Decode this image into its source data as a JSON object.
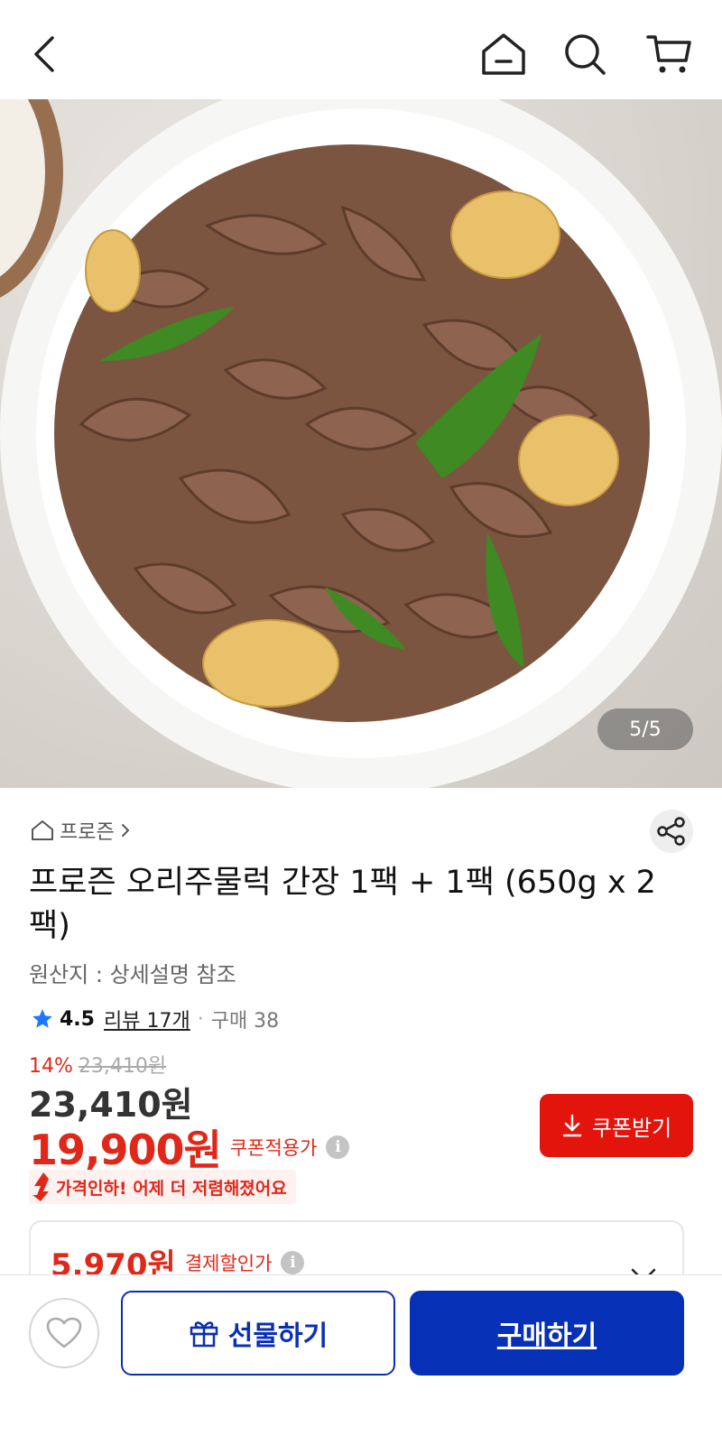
{
  "header": {
    "back_icon": "chevron-left-icon",
    "home_icon": "home-icon",
    "search_icon": "search-icon",
    "cart_icon": "cart-icon"
  },
  "gallery": {
    "counter": "5/5"
  },
  "product": {
    "category": "프로즌",
    "title": "프로즌 오리주물럭 간장 1팩 + 1팩 (650g x 2팩)",
    "origin": "원산지 : 상세설명 참조",
    "rating": "4.5",
    "reviews": "리뷰 17개",
    "purchases": "구매 38"
  },
  "price": {
    "discount_pct": "14%",
    "original": "23,410원",
    "sale": "23,410원",
    "coupon_price": "19,900원",
    "coupon_label": "쿠폰적용가",
    "coupon_button": "쿠폰받기",
    "price_drop_msg": "가격인하! 어제 더 저렴해졌어요",
    "pay_price": "5,970원",
    "pay_label": "결제할인가"
  },
  "bottom": {
    "gift_label": "선물하기",
    "buy_label": "구매하기"
  },
  "colors": {
    "accent_red": "#e0281a",
    "coupon_button": "#e3140b",
    "brand_blue": "#0630b5"
  }
}
